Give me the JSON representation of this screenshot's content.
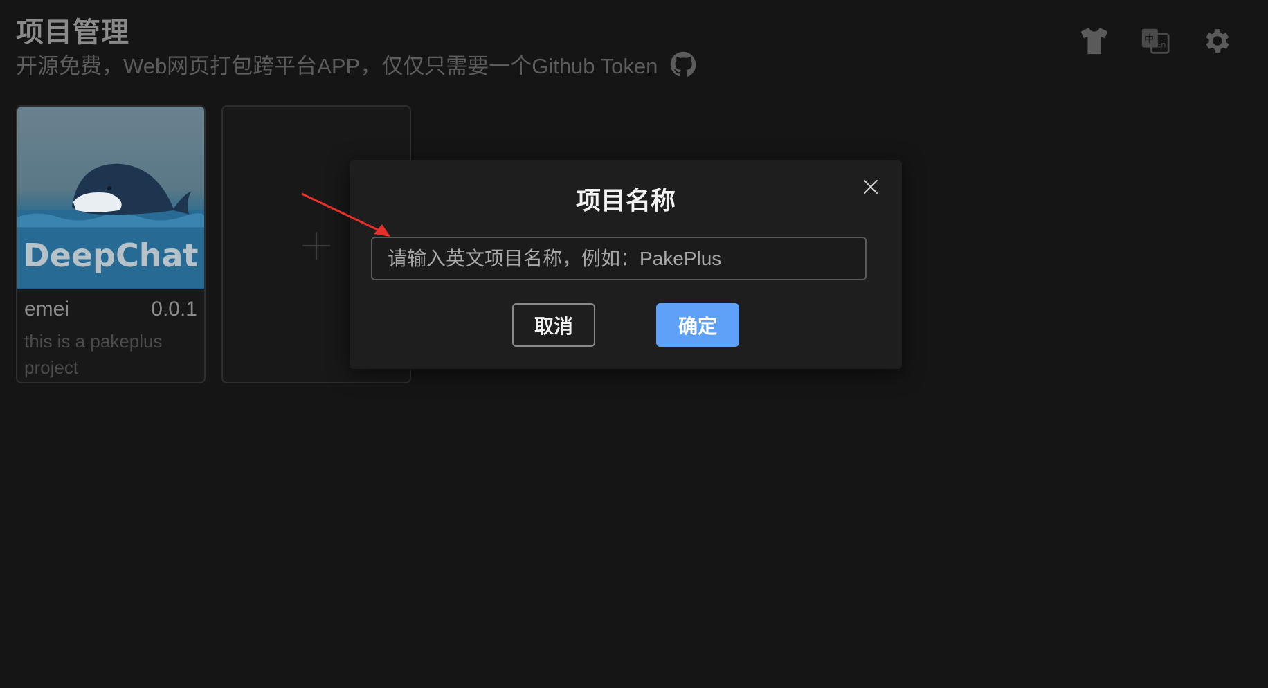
{
  "header": {
    "title": "项目管理",
    "subtitle": "开源免费，Web网页打包跨平台APP，仅仅只需要一个Github Token",
    "icons": [
      "github-icon",
      "tshirt-icon",
      "translate-icon",
      "gear-icon"
    ]
  },
  "projects": [
    {
      "thumbnail_text": "DeepChat",
      "name": "emei",
      "version": "0.0.1",
      "description": "this is a pakeplus project"
    }
  ],
  "add_card": {
    "icon": "plus-icon"
  },
  "dialog": {
    "title": "项目名称",
    "input_placeholder": "请输入英文项目名称，例如：PakePlus",
    "input_value": "",
    "cancel_label": "取消",
    "confirm_label": "确定",
    "close_icon": "close-icon"
  },
  "colors": {
    "background": "#151515",
    "dialog_background": "#1e1e1e",
    "primary": "#5ea1f8",
    "annotation_arrow": "#e8302b"
  }
}
